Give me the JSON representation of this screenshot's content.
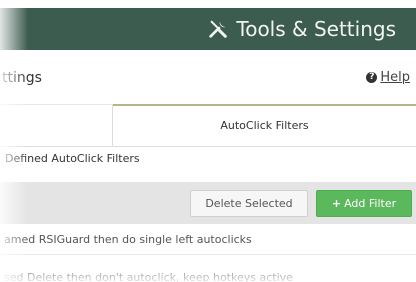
{
  "header": {
    "title": "Tools & Settings",
    "icon": "tools-icon",
    "background_color": "#3d5c50"
  },
  "subbar": {
    "title": "ttings",
    "help_label": "Help",
    "help_icon": "question-circle-icon"
  },
  "tabs": {
    "active_label": "AutoClick Filters",
    "active_border_color": "#b5b48a"
  },
  "section": {
    "title": "Defined AutoClick Filters"
  },
  "toolbar": {
    "delete_label": "Delete Selected",
    "add_label": "Add Filter",
    "add_icon": "plus-icon",
    "add_color": "#5cb85c"
  },
  "rows": [
    {
      "text": "amed RSIGuard then do single left autoclicks"
    },
    {
      "text": "sed Delete then don't autoclick, keep hotkeys active"
    }
  ]
}
